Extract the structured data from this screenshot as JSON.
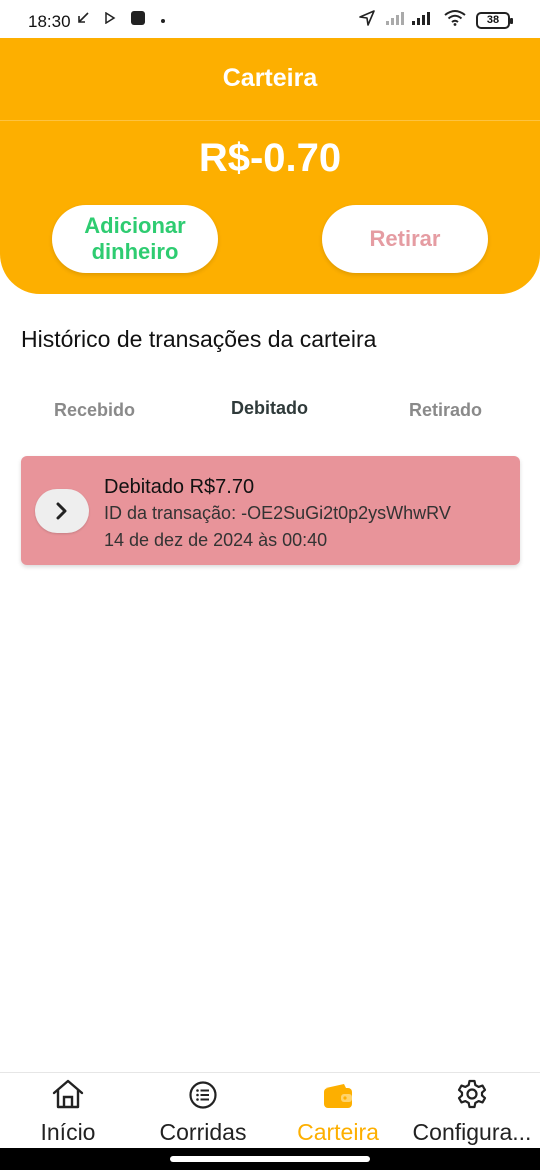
{
  "status_bar": {
    "time": "18:30",
    "battery": "38",
    "icons": [
      "call-forward-icon",
      "play-icon",
      "square-notification-icon",
      "dot-icon",
      "navigation-icon",
      "signal-icon",
      "wifi-icon",
      "battery-icon"
    ]
  },
  "header": {
    "title": "Carteira",
    "balance": "R$-0.70",
    "add_money_label": "Adicionar dinheiro",
    "withdraw_label": "Retirar"
  },
  "history": {
    "title": "Histórico de transações da carteira",
    "tabs": [
      {
        "label": "Recebido",
        "active": false
      },
      {
        "label": "Debitado",
        "active": true
      },
      {
        "label": "Retirado",
        "active": false
      }
    ],
    "transactions": [
      {
        "amount_text": "Debitado R$7.70",
        "id_text": "ID da transação: -OE2SuGi2t0p2ysWhwRV",
        "date_text": "14 de dez de 2024 às 00:40"
      }
    ]
  },
  "bottom_nav": {
    "items": [
      {
        "label": "Início",
        "icon": "home-icon",
        "active": false
      },
      {
        "label": "Corridas",
        "icon": "list-icon",
        "active": false
      },
      {
        "label": "Carteira",
        "icon": "wallet-icon",
        "active": true
      },
      {
        "label": "Configura...",
        "icon": "gear-icon",
        "active": false
      }
    ]
  },
  "colors": {
    "accent": "#FDAF00",
    "add_money_text": "#2ECC71",
    "withdraw_text": "#E59CA2",
    "transaction_card": "#E8949A"
  }
}
